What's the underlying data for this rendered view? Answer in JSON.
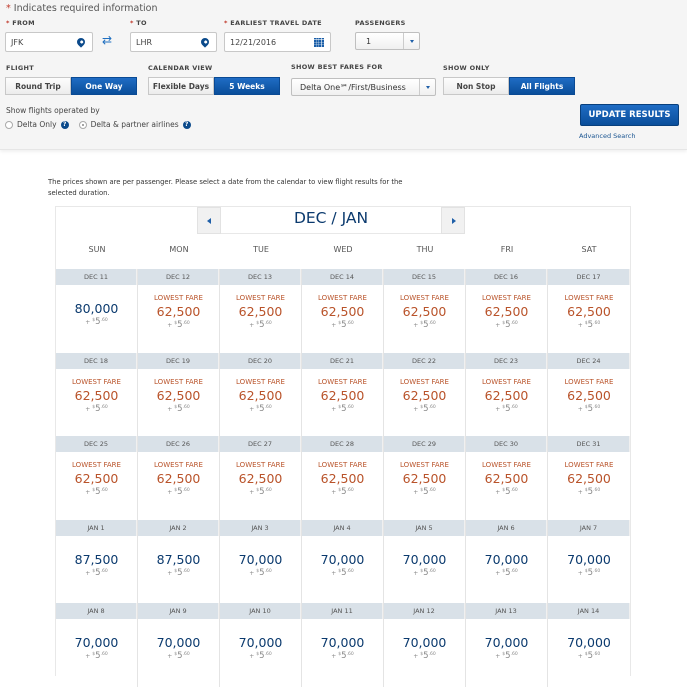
{
  "form": {
    "required_note": "Indicates required information",
    "from": {
      "label": "FROM",
      "value": "JFK",
      "icon": "location-pin-icon"
    },
    "swap_icon": "swap-arrows-icon",
    "to": {
      "label": "TO",
      "value": "LHR",
      "icon": "location-pin-icon"
    },
    "date": {
      "label": "EARLIEST TRAVEL DATE",
      "value": "12/21/2016",
      "icon": "calendar-icon"
    },
    "passengers": {
      "label": "PASSENGERS",
      "value": "1"
    },
    "flight": {
      "label": "FLIGHT",
      "options": [
        "Round Trip",
        "One Way"
      ],
      "selected": "One Way"
    },
    "calendar_view": {
      "label": "CALENDAR VIEW",
      "options": [
        "Flexible Days",
        "5 Weeks"
      ],
      "selected": "5 Weeks"
    },
    "best_fares": {
      "label": "SHOW BEST FARES FOR",
      "value": "Delta One℠/First/Business"
    },
    "show_only": {
      "label": "SHOW ONLY",
      "options": [
        "Non Stop",
        "All Flights"
      ],
      "selected": "All Flights"
    },
    "operated_by": {
      "label": "Show flights operated by",
      "options": [
        {
          "label": "Delta Only",
          "checked": false
        },
        {
          "label": "Delta & partner airlines",
          "checked": true
        }
      ]
    },
    "update_button": "UPDATE RESULTS",
    "advanced_search": "Advanced Search"
  },
  "notice": "The prices shown are per passenger. Please select a date from the calendar to view flight results for the selected duration.",
  "calendar": {
    "month_title": "DEC / JAN",
    "days_of_week": [
      "SUN",
      "MON",
      "TUE",
      "WED",
      "THU",
      "FRI",
      "SAT"
    ],
    "lowest_label": "LOWEST FARE",
    "tax": {
      "prefix": "+",
      "currency": "$",
      "whole": "5",
      "cents": ".60"
    },
    "weeks": [
      [
        {
          "date": "DEC 11",
          "price": "80,000",
          "lowest": false
        },
        {
          "date": "DEC 12",
          "price": "62,500",
          "lowest": true
        },
        {
          "date": "DEC 13",
          "price": "62,500",
          "lowest": true
        },
        {
          "date": "DEC 14",
          "price": "62,500",
          "lowest": true
        },
        {
          "date": "DEC 15",
          "price": "62,500",
          "lowest": true
        },
        {
          "date": "DEC 16",
          "price": "62,500",
          "lowest": true
        },
        {
          "date": "DEC 17",
          "price": "62,500",
          "lowest": true
        }
      ],
      [
        {
          "date": "DEC 18",
          "price": "62,500",
          "lowest": true
        },
        {
          "date": "DEC 19",
          "price": "62,500",
          "lowest": true
        },
        {
          "date": "DEC 20",
          "price": "62,500",
          "lowest": true
        },
        {
          "date": "DEC 21",
          "price": "62,500",
          "lowest": true
        },
        {
          "date": "DEC 22",
          "price": "62,500",
          "lowest": true
        },
        {
          "date": "DEC 23",
          "price": "62,500",
          "lowest": true
        },
        {
          "date": "DEC 24",
          "price": "62,500",
          "lowest": true
        }
      ],
      [
        {
          "date": "DEC 25",
          "price": "62,500",
          "lowest": true
        },
        {
          "date": "DEC 26",
          "price": "62,500",
          "lowest": true
        },
        {
          "date": "DEC 27",
          "price": "62,500",
          "lowest": true
        },
        {
          "date": "DEC 28",
          "price": "62,500",
          "lowest": true
        },
        {
          "date": "DEC 29",
          "price": "62,500",
          "lowest": true
        },
        {
          "date": "DEC 30",
          "price": "62,500",
          "lowest": true
        },
        {
          "date": "DEC 31",
          "price": "62,500",
          "lowest": true
        }
      ],
      [
        {
          "date": "JAN 1",
          "price": "87,500",
          "lowest": false
        },
        {
          "date": "JAN 2",
          "price": "87,500",
          "lowest": false
        },
        {
          "date": "JAN 3",
          "price": "70,000",
          "lowest": false
        },
        {
          "date": "JAN 4",
          "price": "70,000",
          "lowest": false
        },
        {
          "date": "JAN 5",
          "price": "70,000",
          "lowest": false
        },
        {
          "date": "JAN 6",
          "price": "70,000",
          "lowest": false
        },
        {
          "date": "JAN 7",
          "price": "70,000",
          "lowest": false
        }
      ],
      [
        {
          "date": "JAN 8",
          "price": "70,000",
          "lowest": false
        },
        {
          "date": "JAN 9",
          "price": "70,000",
          "lowest": false
        },
        {
          "date": "JAN 10",
          "price": "70,000",
          "lowest": false
        },
        {
          "date": "JAN 11",
          "price": "70,000",
          "lowest": false
        },
        {
          "date": "JAN 12",
          "price": "70,000",
          "lowest": false
        },
        {
          "date": "JAN 13",
          "price": "70,000",
          "lowest": false
        },
        {
          "date": "JAN 14",
          "price": "70,000",
          "lowest": false
        }
      ]
    ]
  },
  "colors": {
    "brand_blue": "#0a4e9a",
    "lowest_fare": "#b9532a",
    "price_text": "#0b3a6e",
    "date_header_bg": "#d9e1e8"
  }
}
